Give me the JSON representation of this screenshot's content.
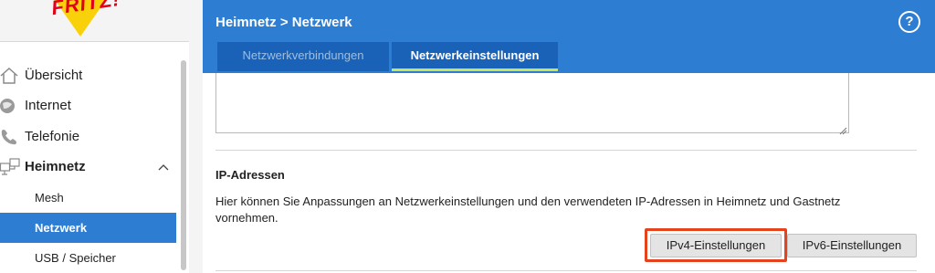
{
  "logo": {
    "text": "FRITZ!"
  },
  "breadcrumb": "Heimnetz > Netzwerk",
  "help": {
    "label": "?"
  },
  "tabs": [
    {
      "label": "Netzwerkverbindungen",
      "active": false
    },
    {
      "label": "Netzwerkeinstellungen",
      "active": true
    }
  ],
  "sidebar": {
    "items": [
      {
        "label": "Übersicht",
        "icon": "home-icon"
      },
      {
        "label": "Internet",
        "icon": "globe-icon"
      },
      {
        "label": "Telefonie",
        "icon": "phone-icon"
      },
      {
        "label": "Heimnetz",
        "icon": "network-icon",
        "expanded": true
      }
    ],
    "subitems": [
      {
        "label": "Mesh",
        "active": false
      },
      {
        "label": "Netzwerk",
        "active": true
      },
      {
        "label": "USB / Speicher",
        "active": false
      }
    ]
  },
  "section": {
    "title": "IP-Adressen",
    "description": "Hier können Sie Anpassungen an Netzwerkeinstellungen und den verwendeten IP-Adressen in Heimnetz und Gastnetz vornehmen."
  },
  "buttons": {
    "ipv4": "IPv4-Einstellungen",
    "ipv6": "IPv6-Einstellungen"
  },
  "colors": {
    "accent": "#2d7dd2",
    "tab_dark": "#1a61b8",
    "active_underline": "#c9e35a",
    "highlight": "#e5421e"
  }
}
